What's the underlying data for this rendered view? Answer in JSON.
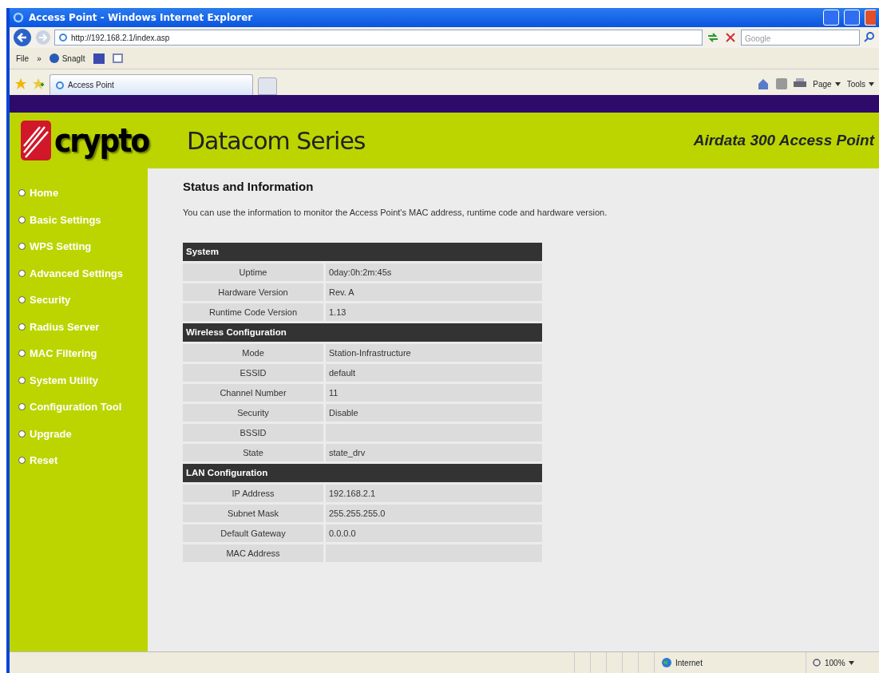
{
  "window": {
    "title": "Access Point - Windows Internet Explorer"
  },
  "address_bar": {
    "url": "http://192.168.2.1/index.asp",
    "search_placeholder": "Google"
  },
  "menu_bar": {
    "items": [
      "File",
      "»",
      "SnagIt"
    ]
  },
  "tabs": [
    {
      "label": "Access Point",
      "selected": true
    }
  ],
  "command_bar": {
    "items": [
      "Page",
      "Tools"
    ]
  },
  "header": {
    "logo": "crypto",
    "series": "Datacom Series",
    "product": "Airdata 300 Access Point"
  },
  "sidebar": {
    "items": [
      {
        "label": "Home"
      },
      {
        "label": "Basic Settings"
      },
      {
        "label": "WPS Setting"
      },
      {
        "label": "Advanced Settings"
      },
      {
        "label": "Security"
      },
      {
        "label": "Radius Server"
      },
      {
        "label": "MAC Filtering"
      },
      {
        "label": "System Utility"
      },
      {
        "label": "Configuration Tool"
      },
      {
        "label": "Upgrade"
      },
      {
        "label": "Reset"
      }
    ]
  },
  "content": {
    "title": "Status and Information",
    "description": "You can use the information to monitor the Access Point's MAC address, runtime code and hardware version.",
    "sections": [
      {
        "title": "System",
        "rows": [
          {
            "label": "Uptime",
            "value": "0day:0h:2m:45s"
          },
          {
            "label": "Hardware Version",
            "value": "Rev. A"
          },
          {
            "label": "Runtime Code Version",
            "value": "1.13"
          }
        ]
      },
      {
        "title": "Wireless Configuration",
        "rows": [
          {
            "label": "Mode",
            "value": "Station-Infrastructure"
          },
          {
            "label": "ESSID",
            "value": "default"
          },
          {
            "label": "Channel Number",
            "value": "11"
          },
          {
            "label": "Security",
            "value": "Disable"
          },
          {
            "label": "BSSID"
          },
          {
            "label": "State",
            "value": "state_drv"
          }
        ]
      },
      {
        "title": "LAN Configuration",
        "rows": [
          {
            "label": "IP Address",
            "value": "192.168.2.1"
          },
          {
            "label": "Subnet Mask",
            "value": "255.255.255.0"
          },
          {
            "label": "Default Gateway",
            "value": "0.0.0.0"
          },
          {
            "label": "MAC Address"
          }
        ]
      }
    ]
  },
  "status_bar": {
    "zone": "Internet",
    "zoom": "100%"
  }
}
